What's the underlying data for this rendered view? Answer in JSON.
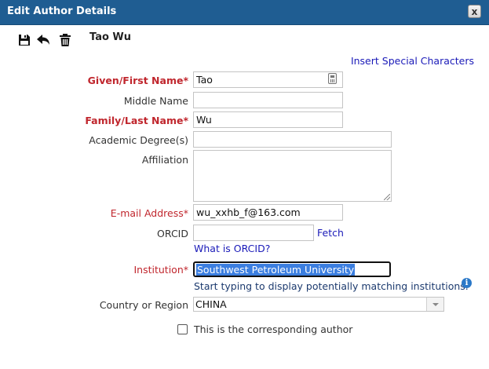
{
  "dialog": {
    "title": "Edit Author Details",
    "close_label": "x"
  },
  "toolbar": {
    "save_icon": "floppy-disk-icon",
    "undo_icon": "undo-arrow-icon",
    "delete_icon": "trash-can-icon"
  },
  "author_name": "Tao Wu",
  "insert_special_characters": "Insert Special Characters",
  "fields": {
    "given_name": {
      "label": "Given/First Name*",
      "value": "Tao"
    },
    "middle_name": {
      "label": "Middle Name",
      "value": ""
    },
    "family_name": {
      "label": "Family/Last Name*",
      "value": "Wu"
    },
    "academic_degree": {
      "label": "Academic Degree(s)",
      "value": ""
    },
    "affiliation": {
      "label": "Affiliation",
      "value": ""
    },
    "email": {
      "label": "E-mail Address*",
      "value": "wu_xxhb_f@163.com"
    },
    "orcid": {
      "label": "ORCID",
      "value": "",
      "fetch_label": "Fetch",
      "what_is_label": "What is ORCID?"
    },
    "institution": {
      "label": "Institution*",
      "value": "Southwest Petroleum University",
      "hint": "Start typing to display potentially matching institutions."
    },
    "country": {
      "label": "Country or Region",
      "value": "CHINA"
    }
  },
  "corresponding_author": {
    "label": "This is the corresponding author",
    "checked": false
  },
  "colors": {
    "titlebar": "#1f5d92",
    "required_label": "#c0262d",
    "link": "#1a1ab8",
    "selection": "#3b7ee0"
  }
}
